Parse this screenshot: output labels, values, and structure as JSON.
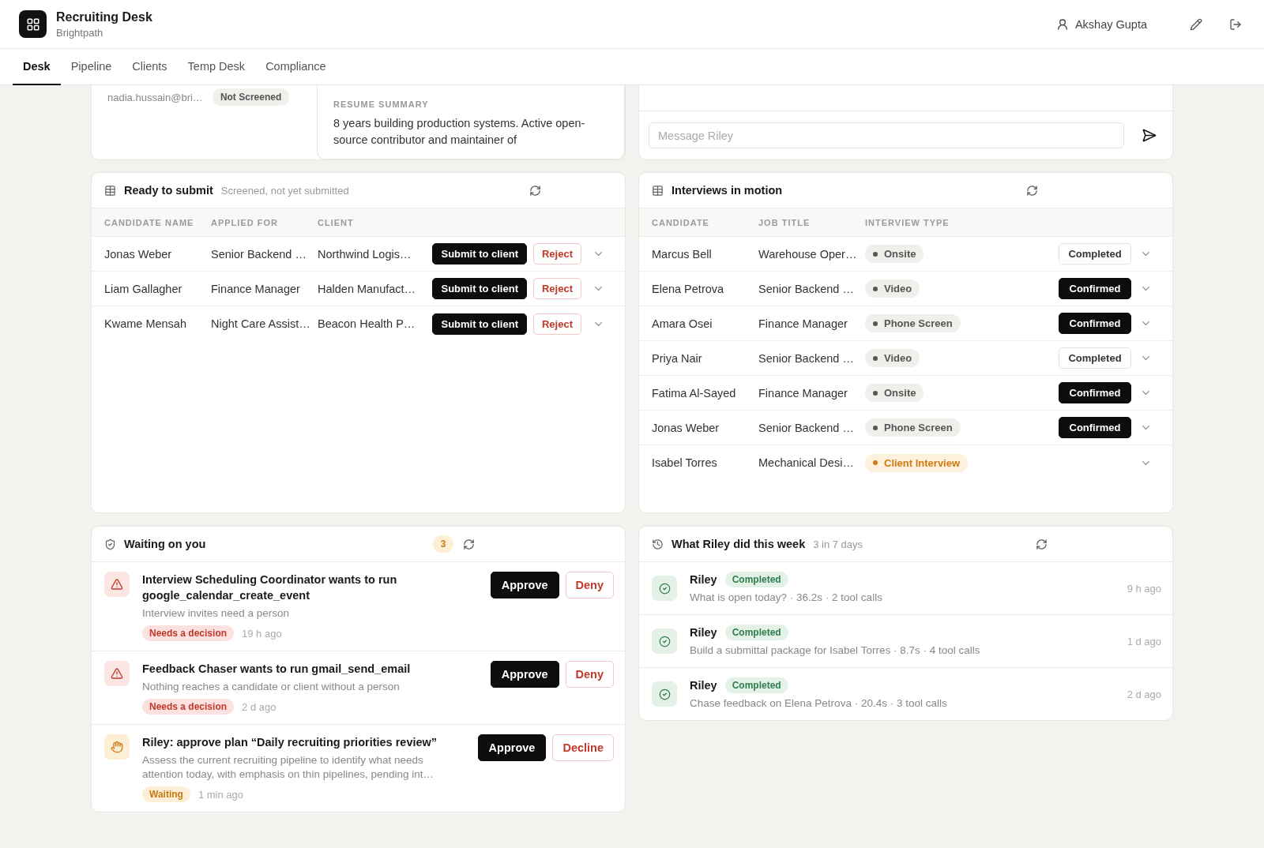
{
  "header": {
    "app_title": "Recruiting Desk",
    "org": "Brightpath",
    "user_name": "Akshay Gupta"
  },
  "tabs": [
    {
      "label": "Desk",
      "selected": true
    },
    {
      "label": "Pipeline",
      "selected": false
    },
    {
      "label": "Clients",
      "selected": false
    },
    {
      "label": "Temp Desk",
      "selected": false
    },
    {
      "label": "Compliance",
      "selected": false
    }
  ],
  "top_cards": {
    "candidate": {
      "email": "nadia.hussain@bri…",
      "status": "Not Screened"
    },
    "resume": {
      "label": "RESUME SUMMARY",
      "summary": "8 years building production systems. Active open-source contributor and maintainer of"
    },
    "chat": {
      "placeholder": "Message Riley"
    }
  },
  "ready": {
    "title": "Ready to submit",
    "subtitle": "Screened, not yet submitted",
    "columns": [
      "CANDIDATE NAME",
      "APPLIED FOR",
      "CLIENT"
    ],
    "rows": [
      {
        "name": "Jonas Weber",
        "applied_for": "Senior Backend …",
        "client": "Northwind Logis…",
        "submit_label": "Submit to client",
        "reject_label": "Reject"
      },
      {
        "name": "Liam Gallagher",
        "applied_for": "Finance Manager",
        "client": "Halden Manufact…",
        "submit_label": "Submit to client",
        "reject_label": "Reject"
      },
      {
        "name": "Kwame Mensah",
        "applied_for": "Night Care Assist…",
        "client": "Beacon Health P…",
        "submit_label": "Submit to client",
        "reject_label": "Reject"
      }
    ]
  },
  "interviews": {
    "title": "Interviews in motion",
    "columns": [
      "CANDIDATE",
      "JOB TITLE",
      "INTERVIEW TYPE"
    ],
    "rows": [
      {
        "candidate": "Marcus Bell",
        "job_title": "Warehouse Oper…",
        "interview_type": {
          "label": "Onsite",
          "kind": "standard"
        },
        "status": {
          "label": "Completed",
          "kind": "completed"
        }
      },
      {
        "candidate": "Elena Petrova",
        "job_title": "Senior Backend …",
        "interview_type": {
          "label": "Video",
          "kind": "standard"
        },
        "status": {
          "label": "Confirmed",
          "kind": "confirmed"
        }
      },
      {
        "candidate": "Amara Osei",
        "job_title": "Finance Manager",
        "interview_type": {
          "label": "Phone Screen",
          "kind": "standard"
        },
        "status": {
          "label": "Confirmed",
          "kind": "confirmed"
        }
      },
      {
        "candidate": "Priya Nair",
        "job_title": "Senior Backend …",
        "interview_type": {
          "label": "Video",
          "kind": "standard"
        },
        "status": {
          "label": "Completed",
          "kind": "completed"
        }
      },
      {
        "candidate": "Fatima Al-Sayed",
        "job_title": "Finance Manager",
        "interview_type": {
          "label": "Onsite",
          "kind": "standard"
        },
        "status": {
          "label": "Confirmed",
          "kind": "confirmed"
        }
      },
      {
        "candidate": "Jonas Weber",
        "job_title": "Senior Backend …",
        "interview_type": {
          "label": "Phone Screen",
          "kind": "standard"
        },
        "status": {
          "label": "Confirmed",
          "kind": "confirmed"
        }
      },
      {
        "candidate": "Isabel Torres",
        "job_title": "Mechanical Desi…",
        "interview_type": {
          "label": "Client Interview",
          "kind": "client"
        }
      }
    ]
  },
  "waiting": {
    "title": "Waiting on you",
    "count": "3",
    "items": [
      {
        "kind": "alert",
        "title": "Interview Scheduling Coordinator wants to run google_calendar_create_event",
        "detail": "Interview invites need a person",
        "tag": {
          "label": "Needs a decision",
          "kind": "decision"
        },
        "time": "19 h ago",
        "approve_label": "Approve",
        "deny_label": "Deny"
      },
      {
        "kind": "alert",
        "title": "Feedback Chaser wants to run gmail_send_email",
        "detail": "Nothing reaches a candidate or client without a person",
        "tag": {
          "label": "Needs a decision",
          "kind": "decision"
        },
        "time": "2 d ago",
        "approve_label": "Approve",
        "deny_label": "Deny"
      },
      {
        "kind": "plan",
        "title": "Riley: approve plan “Daily recruiting priorities review”",
        "detail": "Assess the current recruiting pipeline to identify what needs attention today, with emphasis on thin pipelines, pending int…",
        "tag": {
          "label": "Waiting",
          "kind": "waiting"
        },
        "time": "1 min ago",
        "approve_label": "Approve",
        "deny_label": "Decline"
      }
    ]
  },
  "activity": {
    "title": "What Riley did this week",
    "subtitle": "3 in 7 days",
    "items": [
      {
        "agent": "Riley",
        "status": "Completed",
        "summary": "What is open today? · 36.2s · 2 tool calls",
        "time": "9 h ago"
      },
      {
        "agent": "Riley",
        "status": "Completed",
        "summary": "Build a submittal package for Isabel Torres · 8.7s · 4 tool calls",
        "time": "1 d ago"
      },
      {
        "agent": "Riley",
        "status": "Completed",
        "summary": "Chase feedback on Elena Petrova · 20.4s · 3 tool calls",
        "time": "2 d ago"
      }
    ]
  }
}
